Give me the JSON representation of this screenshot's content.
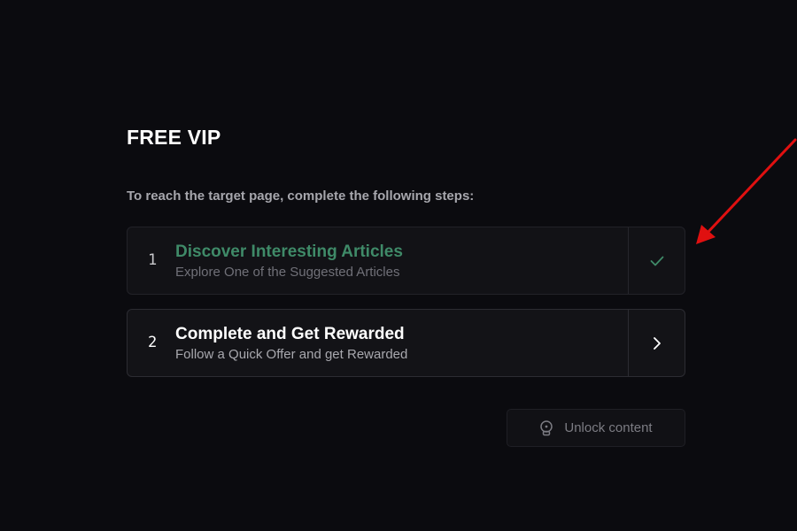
{
  "page": {
    "title": "FREE VIP",
    "subtitle": "To reach the target page, complete the following steps:"
  },
  "steps": [
    {
      "number": "1",
      "heading": "Discover Interesting Articles",
      "description": "Explore One of the Suggested Articles",
      "status": "completed",
      "icon": "check-icon"
    },
    {
      "number": "2",
      "heading": "Complete and Get Rewarded",
      "description": "Follow a Quick Offer and get Rewarded",
      "status": "pending",
      "icon": "chevron-right-icon"
    }
  ],
  "unlock": {
    "label": "Unlock content",
    "icon": "lock-icon"
  },
  "colors": {
    "background": "#0b0b0f",
    "completed_accent": "#3f8a68",
    "annotation_arrow": "#e01010"
  }
}
